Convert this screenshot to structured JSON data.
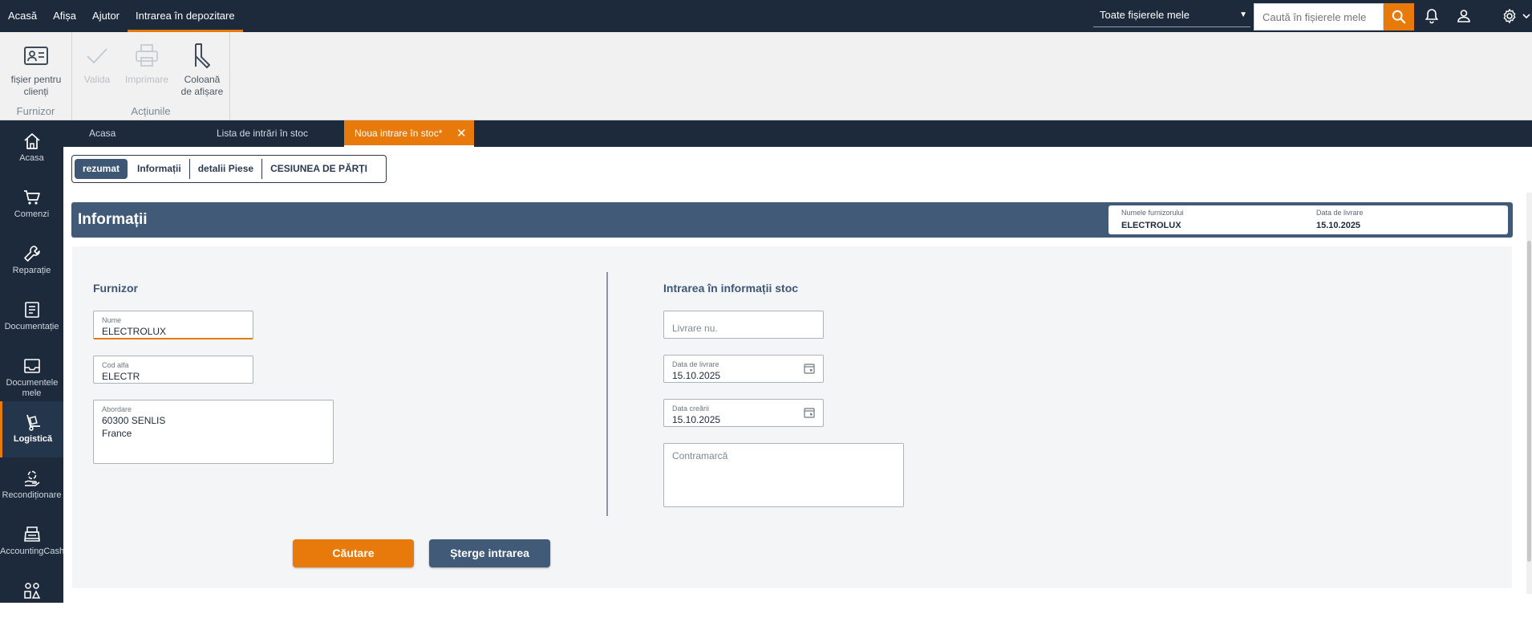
{
  "topbar": {
    "menu": [
      {
        "label": "Acasă"
      },
      {
        "label": "Afișa"
      },
      {
        "label": "Ajutor"
      },
      {
        "label": "Intrarea în depozitare"
      }
    ],
    "files_filter": "Toate fișierele mele",
    "search_placeholder": "Caută în fișierele mele",
    "accent": "#e87a0c",
    "icons": [
      "search-icon",
      "bell-icon",
      "user-icon",
      "gear-icon",
      "chevron-down-icon"
    ]
  },
  "ribbon": {
    "groups": [
      {
        "label": "Furnizor",
        "buttons": [
          {
            "label": "fișier pentru clienți",
            "icon": "contact-card-icon"
          }
        ]
      },
      {
        "label": "Acțiunile",
        "buttons": [
          {
            "label": "Valida",
            "icon": "check-icon",
            "enabled": false
          },
          {
            "label": "Imprimare",
            "icon": "printer-icon",
            "enabled": false
          },
          {
            "label": "Coloană de afișare",
            "icon": "column-icon",
            "enabled": true
          }
        ]
      }
    ]
  },
  "leftnav": {
    "items": [
      {
        "label": "Acasa",
        "icon": "home-icon"
      },
      {
        "label": "Comenzi",
        "icon": "cart-icon"
      },
      {
        "label": "Reparație",
        "icon": "wrench-icon"
      },
      {
        "label": "Documentație",
        "icon": "document-icon"
      },
      {
        "label": "Documentele mele",
        "icon": "inbox-icon"
      },
      {
        "label": "Logistică",
        "icon": "hand-truck-icon",
        "active": true
      },
      {
        "label": "Recondiționare",
        "icon": "recycle-hand-icon"
      },
      {
        "label": "AccountingCash",
        "icon": "cash-register-icon"
      },
      {
        "label": "",
        "icon": "shapes-icon"
      }
    ]
  },
  "tabs": [
    {
      "label": "Acasa",
      "closable": false
    },
    {
      "label": "Lista de intrări în stoc",
      "closable": true
    },
    {
      "label": "Noua intrare în stoc*",
      "closable": true,
      "active": true
    }
  ],
  "segments": [
    "rezumat",
    "Informații",
    "detalii Piese",
    "CESIUNEA DE PĂRȚI"
  ],
  "info_header": {
    "title": "Informații",
    "supplier_label": "Numele furnizorului",
    "supplier_value": "ELECTROLUX",
    "delivery_label": "Data de livrare",
    "delivery_value": "15.10.2025"
  },
  "supplier_section": {
    "title": "Furnizor",
    "name_label": "Nume",
    "name_value": "ELECTROLUX",
    "alpha_label": "Cod alfa",
    "alpha_value": "ELECTR",
    "address_label": "Abordare",
    "address_value": "60300 SENLIS\nFrance"
  },
  "stock_section": {
    "title": "Intrarea în informații stoc",
    "delivery_no_placeholder": "Livrare nu.",
    "delivery_date_label": "Data de livrare",
    "delivery_date_value": "15.10.2025",
    "creation_date_label": "Data creării",
    "creation_date_value": "15.10.2025",
    "countermark_placeholder": "Contramarcă"
  },
  "actions": {
    "search_label": "Căutare",
    "delete_label": "Șterge intrarea"
  }
}
